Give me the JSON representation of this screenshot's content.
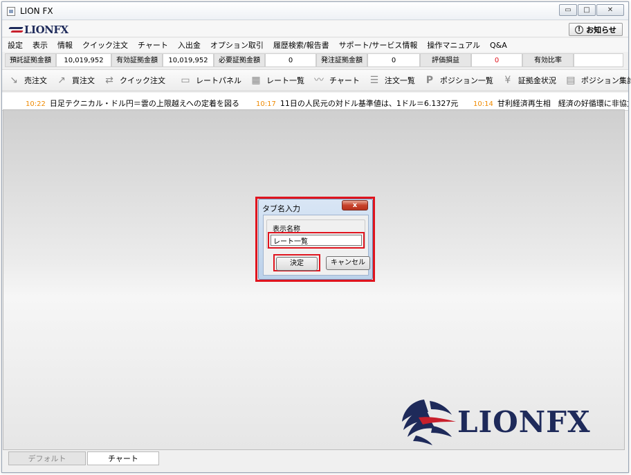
{
  "window": {
    "title": "LION FX",
    "buttons": {
      "minimize": "▭",
      "maximize": "□",
      "close": "✕"
    }
  },
  "header": {
    "logo_text": "LIONFX",
    "notice_label": "お知らせ",
    "notice_icon": "!"
  },
  "menu": [
    "設定",
    "表示",
    "情報",
    "クイック注文",
    "チャート",
    "入出金",
    "オプション取引",
    "履歴検索/報告書",
    "サポート/サービス情報",
    "操作マニュアル",
    "Q&A"
  ],
  "account": [
    {
      "label": "預託証拠金額",
      "value": "10,019,952"
    },
    {
      "label": "有効証拠金額",
      "value": "10,019,952"
    },
    {
      "label": "必要証拠金額",
      "value": "0"
    },
    {
      "label": "発注証拠金額",
      "value": "0"
    },
    {
      "label": "評価損益",
      "value": "0"
    },
    {
      "label": "有効比率",
      "value": ""
    }
  ],
  "toolbar": [
    {
      "label": "売注文",
      "icon": "sell-arrow-icon"
    },
    {
      "label": "買注文",
      "icon": "buy-arrow-icon"
    },
    {
      "label": "クイック注文",
      "icon": "quick-order-icon"
    },
    {
      "label": "レートパネル",
      "icon": "rate-panel-icon"
    },
    {
      "label": "レート一覧",
      "icon": "rate-list-icon"
    },
    {
      "label": "チャート",
      "icon": "chart-icon"
    },
    {
      "label": "注文一覧",
      "icon": "order-list-icon"
    },
    {
      "label": "ポジション一覧",
      "icon": "position-list-icon"
    },
    {
      "label": "証拠金状況",
      "icon": "yen-icon"
    },
    {
      "label": "ポジション集計",
      "icon": "position-summary-icon"
    }
  ],
  "ticker": [
    {
      "time": "10:22",
      "text": "日足テクニカル・ドル円＝雲の上限越えへの定着を図る"
    },
    {
      "time": "10:17",
      "text": "11日の人民元の対ドル基準値は、1ドル＝6.1327元"
    },
    {
      "time": "10:14",
      "text": "甘利経済再生相　経済の好循環に非協力"
    }
  ],
  "dialog": {
    "title": "タブ名入力",
    "close_label": "x",
    "group_label": "表示名称",
    "input_value": "レート一覧",
    "ok_label": "決定",
    "cancel_label": "キャンセル"
  },
  "watermark_logo": "LIONFX",
  "tabs": [
    {
      "label": "デフォルト",
      "active": false
    },
    {
      "label": "チャート",
      "active": true
    }
  ],
  "colors": {
    "highlight": "#e0141e",
    "ticker_time": "#f08a00",
    "brand_navy": "#1e2a5a",
    "brand_red": "#c8202c"
  }
}
